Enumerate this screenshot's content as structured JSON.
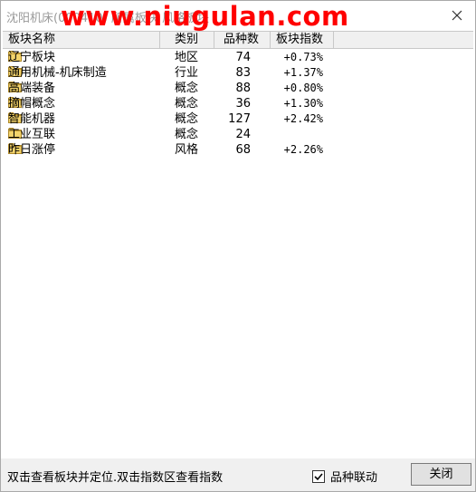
{
  "window": {
    "title": "沈阳机床(000410) 所属板块 风格板块",
    "watermark": "www.niugulan.com"
  },
  "table": {
    "columns": [
      "板块名称",
      "类别",
      "品种数",
      "板块指数"
    ],
    "rows": [
      {
        "name": "辽宁板块",
        "type": "地区",
        "count": "74",
        "index": "+0.73%"
      },
      {
        "name": "通用机械-机床制造",
        "type": "行业",
        "count": "83",
        "index": "+1.37%"
      },
      {
        "name": "高端装备",
        "type": "概念",
        "count": "88",
        "index": "+0.80%"
      },
      {
        "name": "摘帽概念",
        "type": "概念",
        "count": "36",
        "index": "+1.30%"
      },
      {
        "name": "智能机器",
        "type": "概念",
        "count": "127",
        "index": "+2.42%"
      },
      {
        "name": "工业互联",
        "type": "概念",
        "count": "24",
        "index": ""
      },
      {
        "name": "昨日涨停",
        "type": "风格",
        "count": "68",
        "index": "+2.26%"
      }
    ]
  },
  "footer": {
    "hint": "双击查看板块并定位.双击指数区查看指数",
    "checkbox_label": "品种联动",
    "checkbox_checked": true,
    "close_label": "关闭"
  },
  "icons": {
    "folder": "folder-icon",
    "close": "close-icon",
    "check": "check-icon"
  }
}
